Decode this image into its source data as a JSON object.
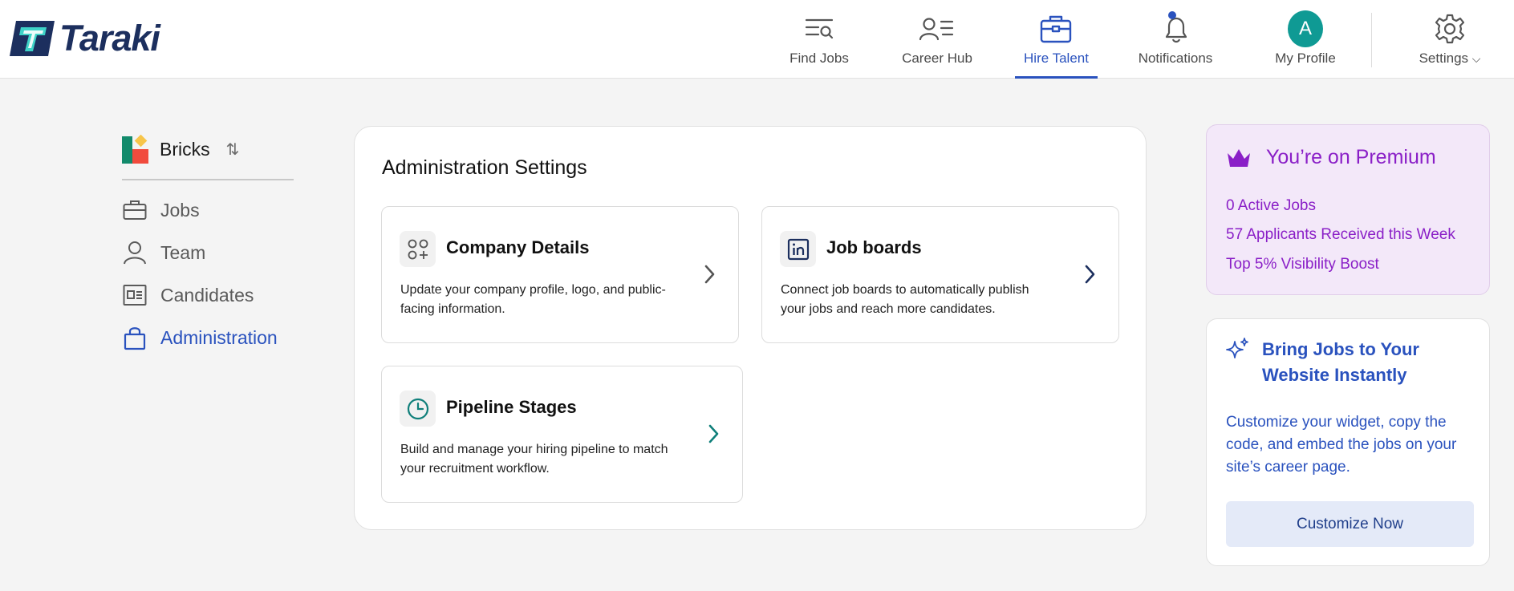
{
  "brand": {
    "name": "Taraki"
  },
  "nav": {
    "items": [
      {
        "label": "Find Jobs",
        "icon": "find-jobs-icon"
      },
      {
        "label": "Career Hub",
        "icon": "career-hub-icon"
      },
      {
        "label": "Hire Talent",
        "icon": "briefcase-icon",
        "active": true
      },
      {
        "label": "Notifications",
        "icon": "bell-icon"
      },
      {
        "label": "My Profile",
        "icon": "avatar"
      },
      {
        "label": "Settings",
        "icon": "gear-icon"
      }
    ],
    "avatar_initial": "A",
    "settings_caret": "⌵"
  },
  "sidebar": {
    "org_name": "Bricks",
    "org_swap": "⇅",
    "items": [
      {
        "label": "Jobs",
        "icon": "briefcase-icon"
      },
      {
        "label": "Team",
        "icon": "user-icon"
      },
      {
        "label": "Candidates",
        "icon": "candidate-card-icon"
      },
      {
        "label": "Administration",
        "icon": "lock-icon",
        "active": true
      }
    ]
  },
  "main": {
    "title": "Administration Settings",
    "cards": [
      {
        "title": "Company Details",
        "description": "Update your company profile, logo, and public-facing information.",
        "icon": "apps-icon"
      },
      {
        "title": "Job boards",
        "description": "Connect job boards to automatically publish your jobs and reach more candidates.",
        "icon": "linkedin-icon"
      },
      {
        "title": "Pipeline Stages",
        "description": "Build and manage your hiring pipeline to match your recruitment workflow.",
        "icon": "clock-icon"
      }
    ]
  },
  "premium": {
    "title": "You’re on Premium",
    "lines": [
      "0 Active Jobs",
      "57 Applicants Received this Week",
      "Top 5% Visibility Boost"
    ]
  },
  "widget": {
    "title": "Bring Jobs to Your Website Instantly",
    "description": "Customize your widget, copy the code, and embed the jobs on your site’s career page.",
    "button": "Customize Now"
  },
  "colors": {
    "accent": "#2a52be",
    "premium": "#8a1fc7",
    "teal": "#0f9a94",
    "brand_navy": "#1c2f5e"
  }
}
